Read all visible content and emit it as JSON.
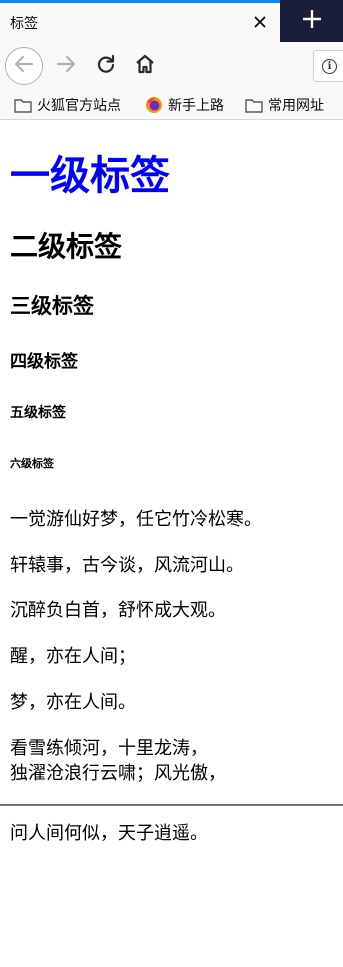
{
  "browser": {
    "tab_title": "标签",
    "bookmarks": [
      {
        "label": "火狐官方站点",
        "icon": "folder-icon"
      },
      {
        "label": "新手上路",
        "icon": "firefox-icon"
      },
      {
        "label": "常用网址",
        "icon": "folder-icon"
      }
    ],
    "accent_color": "#0a84ff"
  },
  "page": {
    "headings": {
      "h1": "一级标签",
      "h2": "二级标签",
      "h3": "三级标签",
      "h4": "四级标签",
      "h5": "五级标签",
      "h6": "六级标签"
    },
    "h1_color": "#0000ff",
    "paragraphs": [
      "一觉游仙好梦，任它竹冷松寒。",
      "轩辕事，古今谈，风流河山。",
      "沉醉负白首，舒怀成大观。",
      "醒，亦在人间；",
      "梦，亦在人间。"
    ],
    "verse_lines": [
      "看雪练倾河，十里龙涛，",
      "独濯沧浪行云啸；风光傲，"
    ],
    "after_rule": "问人间何似，天子逍遥。"
  }
}
